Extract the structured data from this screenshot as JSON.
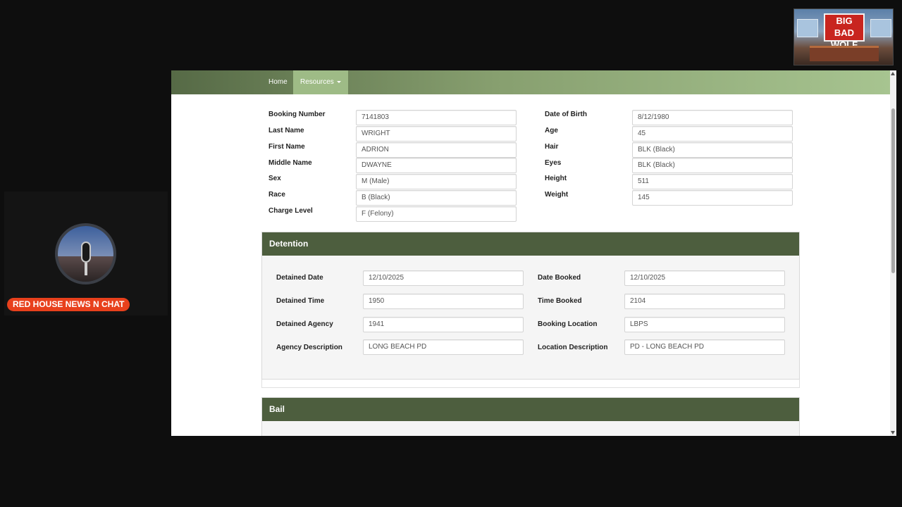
{
  "overlay": {
    "channel_name": "RED HOUSE NEWS N CHAT",
    "brand_logo_text": "BIG BAD WOLF",
    "accent_color": "#e8401c"
  },
  "navbar": {
    "home_label": "Home",
    "resources_label": "Resources"
  },
  "booking": {
    "left": [
      {
        "label": "Booking Number",
        "value": "7141803"
      },
      {
        "label": "Last Name",
        "value": "WRIGHT"
      },
      {
        "label": "First Name",
        "value": "ADRION"
      },
      {
        "label": "Middle Name",
        "value": "DWAYNE"
      },
      {
        "label": "Sex",
        "value": "M (Male)"
      },
      {
        "label": "Race",
        "value": "B (Black)"
      },
      {
        "label": "Charge Level",
        "value": "F (Felony)"
      }
    ],
    "right": [
      {
        "label": "Date of Birth",
        "value": "8/12/1980"
      },
      {
        "label": "Age",
        "value": "45"
      },
      {
        "label": "Hair",
        "value": "BLK (Black)"
      },
      {
        "label": "Eyes",
        "value": "BLK (Black)"
      },
      {
        "label": "Height",
        "value": "511"
      },
      {
        "label": "Weight",
        "value": "145"
      }
    ]
  },
  "detention": {
    "title": "Detention",
    "left": [
      {
        "label": "Detained Date",
        "value": "12/10/2025"
      },
      {
        "label": "Detained Time",
        "value": "1950"
      },
      {
        "label": "Detained Agency",
        "value": "1941"
      },
      {
        "label": "Agency Description",
        "value": "LONG BEACH PD"
      }
    ],
    "right": [
      {
        "label": "Date Booked",
        "value": "12/10/2025"
      },
      {
        "label": "Time Booked",
        "value": "2104"
      },
      {
        "label": "Booking Location",
        "value": "LBPS"
      },
      {
        "label": "Location Description",
        "value": "PD - LONG BEACH PD"
      }
    ]
  },
  "bail": {
    "title": "Bail"
  },
  "colors": {
    "panel_header": "#4d5e3e",
    "navbar_start": "#566a46",
    "navbar_end": "#a7c490"
  }
}
